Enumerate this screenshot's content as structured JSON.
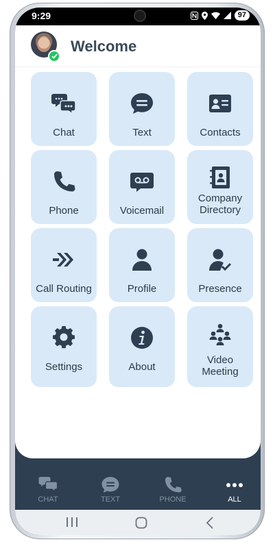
{
  "status_bar": {
    "time": "9:29",
    "battery": "97"
  },
  "header": {
    "title": "Welcome"
  },
  "tiles": [
    {
      "lines": [
        "Chat"
      ],
      "icon": "chat-bubbles-icon"
    },
    {
      "lines": [
        "Text"
      ],
      "icon": "message-bubble-icon"
    },
    {
      "lines": [
        "Contacts"
      ],
      "icon": "contact-card-icon"
    },
    {
      "lines": [
        "Phone"
      ],
      "icon": "phone-icon"
    },
    {
      "lines": [
        "Voicemail"
      ],
      "icon": "voicemail-icon"
    },
    {
      "lines": [
        "Company",
        "Directory"
      ],
      "icon": "directory-book-icon"
    },
    {
      "lines": [
        "Call Routing"
      ],
      "icon": "double-arrow-icon"
    },
    {
      "lines": [
        "Profile"
      ],
      "icon": "person-icon"
    },
    {
      "lines": [
        "Presence"
      ],
      "icon": "person-check-icon"
    },
    {
      "lines": [
        "Settings"
      ],
      "icon": "gear-icon"
    },
    {
      "lines": [
        "About"
      ],
      "icon": "info-icon"
    },
    {
      "lines": [
        "Video",
        "Meeting"
      ],
      "icon": "group-meeting-icon"
    }
  ],
  "bottom_nav": [
    {
      "label": "CHAT",
      "icon": "chat-bubbles-icon"
    },
    {
      "label": "TEXT",
      "icon": "message-bubble-icon"
    },
    {
      "label": "PHONE",
      "icon": "phone-icon"
    },
    {
      "label": "ALL",
      "icon": "more-dots-icon",
      "active": true
    }
  ],
  "colors": {
    "tile_bg": "#d9e9f8",
    "icon": "#2e3f52",
    "nav_bg": "#2e3f52",
    "presence_online": "#22c55e"
  }
}
